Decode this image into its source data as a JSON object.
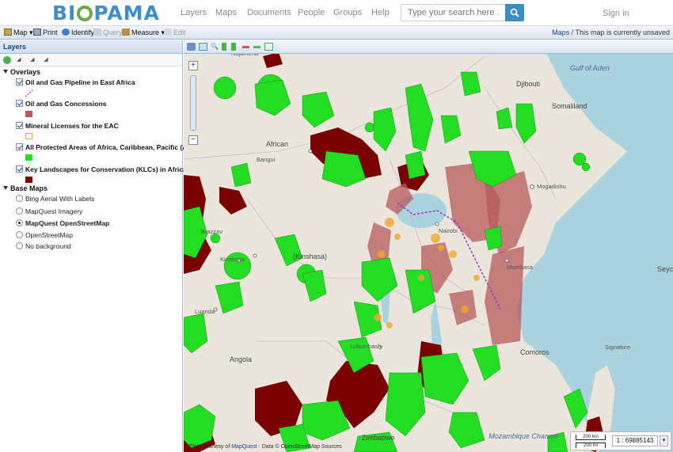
{
  "nav": {
    "logo_left": "BI",
    "logo_right": "PAMA",
    "links": [
      "Layers",
      "Maps",
      "Documents",
      "People",
      "Groups",
      "Help"
    ],
    "search_placeholder": "Type your search here ...",
    "signin": "Sign in"
  },
  "toolbar": {
    "map": "Map",
    "print": "Print",
    "identify": "Identify",
    "query": "Query",
    "measure": "Measure",
    "edit": "Edit",
    "breadcrumb_link": "Maps",
    "status": " / This map is currently unsaved"
  },
  "layers": {
    "title": "Layers",
    "overlays_label": "Overlays",
    "overlays": [
      {
        "label": "Oil and Gas Pipeline in East Africa",
        "color": "#9b2fc4"
      },
      {
        "label": "Oil and Gas Concessions",
        "color": "#b5595a"
      },
      {
        "label": "Mineral Licenses for the EAC",
        "color": "#f4a52f"
      },
      {
        "label": "All Protected Areas of Africa, Caribbean, Pacific (ACP)",
        "color": "#22dd22"
      },
      {
        "label": "Key Landscapes for Conservation (KLCs) in Africa",
        "color": "#7a0000"
      }
    ],
    "basemaps_label": "Base Maps",
    "basemaps": [
      {
        "label": "Bing Aerial With Labels",
        "selected": false
      },
      {
        "label": "MapQuest Imagery",
        "selected": false
      },
      {
        "label": "MapQuest OpenStreetMap",
        "selected": true
      },
      {
        "label": "OpenStreetMap",
        "selected": false
      },
      {
        "label": "No background",
        "selected": false
      }
    ]
  },
  "map": {
    "labels": {
      "gulf": "Gulf of Aden",
      "somaliland": "Somaliland",
      "djibouti": "Djibouti",
      "mogadishu": "Mogadishu",
      "seychelles": "Seyche",
      "comoros": "Comoros",
      "mozambique_channel": "Mozambique Channel",
      "angola": "Angola",
      "luanda": "Luanda",
      "kinshasa": "Kinshasa",
      "brazzaville": "Brazzav",
      "kinshasa_prov": "(Kinshasa)",
      "african": "African",
      "bangui": "Bangui",
      "ndjamena": "Ndjamena",
      "zimbabwe": "Zimbabwe",
      "lubumbashi": "Lubumbashi",
      "mombasa": "Mombasa",
      "nairobi": "Nairobi",
      "signature": "Signature"
    },
    "scale": {
      "km": "200 km",
      "mi": "200 mi",
      "ratio": "1 : 69885143"
    },
    "attribution_prefix": "Tiles Courtesy of",
    "attribution_link": "MapQuest",
    "attribution_suffix": " · Data © OpenStreetMap Sources",
    "colors": {
      "protected": "#22dd22",
      "klc": "#7a0000",
      "concession": "#b5595a",
      "mineral": "#f4a52f",
      "pipeline": "#9b2fc4",
      "water": "#aad3df"
    }
  }
}
